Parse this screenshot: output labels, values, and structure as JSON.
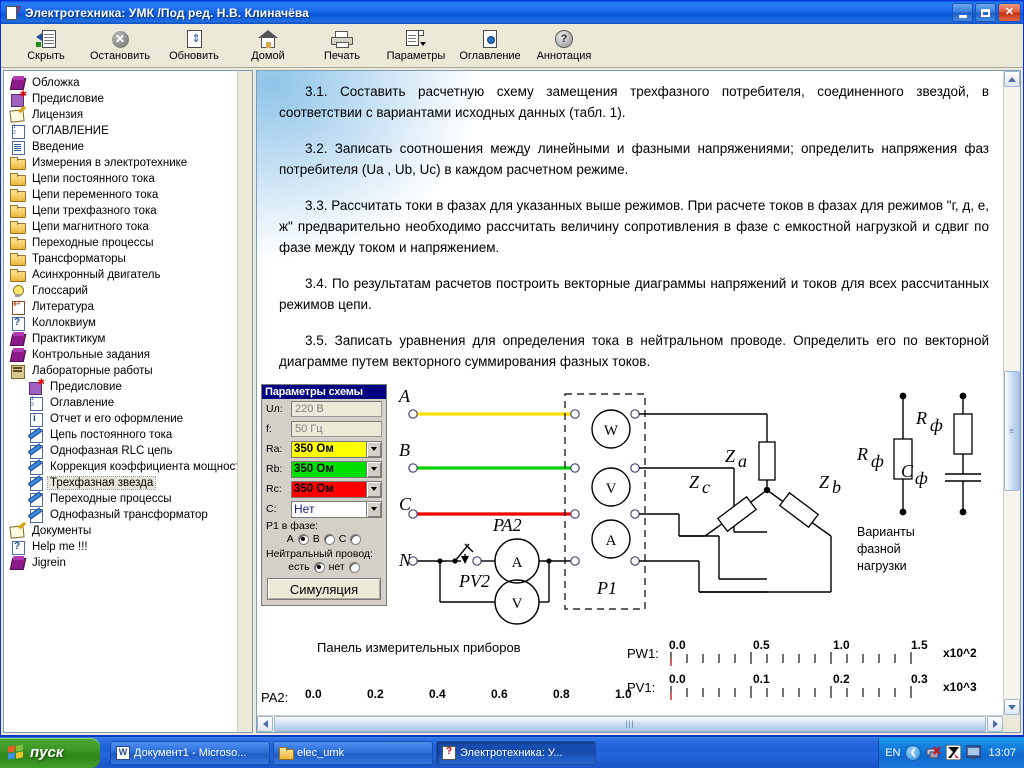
{
  "window": {
    "title": "Электротехника: УМК /Под ред. Н.В. Клиначёва",
    "icon": "help-book-icon",
    "minimize_label": "_",
    "maximize_label": "□",
    "close_label": "✕"
  },
  "toolbar": {
    "items": [
      {
        "label": "Скрыть",
        "icon": "hide-pane-icon"
      },
      {
        "label": "Остановить",
        "icon": "stop-icon"
      },
      {
        "label": "Обновить",
        "icon": "refresh-icon"
      },
      {
        "label": "Домой",
        "icon": "home-icon"
      },
      {
        "label": "Печать",
        "icon": "print-icon"
      },
      {
        "label": "Параметры",
        "icon": "options-icon"
      },
      {
        "label": "Оглавление",
        "icon": "contents-icon"
      },
      {
        "label": "Аннотация",
        "icon": "annotation-icon"
      }
    ]
  },
  "sidebar": {
    "items": [
      {
        "label": "Обложка",
        "icon": "book-icon",
        "level": 1,
        "selected": false
      },
      {
        "label": "Предисловие",
        "icon": "book-new-icon",
        "level": 1,
        "selected": false
      },
      {
        "label": "Лицензия",
        "icon": "license-icon",
        "level": 1,
        "selected": false
      },
      {
        "label": "ОГЛАВЛЕНИЕ",
        "icon": "numbered-list-icon",
        "level": 1,
        "selected": false
      },
      {
        "label": "Введение",
        "icon": "document-icon",
        "level": 1,
        "selected": false
      },
      {
        "label": "Измерения в электротехнике",
        "icon": "folder-icon",
        "level": 1,
        "selected": false
      },
      {
        "label": "Цепи постоянного тока",
        "icon": "folder-icon",
        "level": 1,
        "selected": false
      },
      {
        "label": "Цепи переменного тока",
        "icon": "folder-icon",
        "level": 1,
        "selected": false
      },
      {
        "label": "Цепи трехфазного тока",
        "icon": "folder-icon",
        "level": 1,
        "selected": false
      },
      {
        "label": "Цепи магнитного тока",
        "icon": "folder-icon",
        "level": 1,
        "selected": false
      },
      {
        "label": "Переходные процессы",
        "icon": "folder-icon",
        "level": 1,
        "selected": false
      },
      {
        "label": "Трансформаторы",
        "icon": "folder-icon",
        "level": 1,
        "selected": false
      },
      {
        "label": "Асинхронный двигатель",
        "icon": "folder-icon",
        "level": 1,
        "selected": false
      },
      {
        "label": "Глоссарий",
        "icon": "lightbulb-icon",
        "level": 1,
        "selected": false
      },
      {
        "label": "Литература",
        "icon": "literature-icon",
        "level": 1,
        "selected": false
      },
      {
        "label": "Коллоквиум",
        "icon": "question-icon",
        "level": 1,
        "selected": false
      },
      {
        "label": "Практиктикум",
        "icon": "book-icon",
        "level": 1,
        "selected": false
      },
      {
        "label": "Контрольные задания",
        "icon": "book-icon",
        "level": 1,
        "selected": false
      },
      {
        "label": "Лабораторные работы",
        "icon": "lab-folder-icon",
        "level": 1,
        "selected": false
      },
      {
        "label": "Предисловие",
        "icon": "document-new-icon",
        "level": 2,
        "selected": false
      },
      {
        "label": "Оглавление",
        "icon": "numbered-list-icon",
        "level": 2,
        "selected": false
      },
      {
        "label": "Отчет и его оформление",
        "icon": "info-icon",
        "level": 2,
        "selected": false
      },
      {
        "label": "Цепь постоянного тока",
        "icon": "lab-icon",
        "level": 2,
        "selected": false
      },
      {
        "label": "Однофазная RLC цепь",
        "icon": "lab-icon",
        "level": 2,
        "selected": false
      },
      {
        "label": "Коррекция коэффициента мощности",
        "icon": "lab-icon",
        "level": 2,
        "selected": false
      },
      {
        "label": "Трехфазная звезда",
        "icon": "lab-icon",
        "level": 2,
        "selected": true
      },
      {
        "label": "Переходные процессы",
        "icon": "lab-icon",
        "level": 2,
        "selected": false
      },
      {
        "label": "Однофазный трансформатор",
        "icon": "lab-icon",
        "level": 2,
        "selected": false
      },
      {
        "label": "Документы",
        "icon": "license-icon",
        "level": 1,
        "selected": false
      },
      {
        "label": "Help me !!!",
        "icon": "question-icon",
        "level": 1,
        "selected": false
      },
      {
        "label": "Jigrein",
        "icon": "book-icon",
        "level": 1,
        "selected": false
      }
    ]
  },
  "content": {
    "paragraphs": [
      "3.1. Составить расчетную схему замещения трехфазного потребителя, соединенного звездой, в соответствии с вариантами исходных данных (табл. 1).",
      "3.2. Записать соотношения между линейными и фазными напряжениями; определить напряжения фаз потребителя (Ua , Ub, Uc) в каждом расчетном режиме.",
      "3.3. Рассчитать токи в фазах для указанных выше режимов. При расчете токов в фазах для режимов \"г, д, е, ж\" предварительно необходимо рассчитать величину сопротивления в фазе с емкостной нагрузкой и сдвиг по фазе между током и напряжением.",
      "3.4. По результатам расчетов построить векторные диаграммы напряжений и токов для всех рассчитанных режимов цепи.",
      "3.5. Записать уравнения для определения тока в нейтральном проводе. Определить его по векторной диаграмме путем векторного суммирования фазных токов."
    ]
  },
  "params_panel": {
    "title": "Параметры схемы",
    "fields": [
      {
        "label": "Uл:",
        "value": "220 В",
        "type": "readonly"
      },
      {
        "label": "f:",
        "value": "50 Гц",
        "type": "readonly"
      },
      {
        "label": "Ra:",
        "value": "350 Ом",
        "type": "combo",
        "color": "#ffff00"
      },
      {
        "label": "Rb:",
        "value": "350 Ом",
        "type": "combo",
        "color": "#00e000"
      },
      {
        "label": "Rc:",
        "value": "350 Ом",
        "type": "combo",
        "color": "#ff0000"
      },
      {
        "label": "C:",
        "value": "Нет",
        "type": "combo-wide",
        "color": "#ffffff"
      }
    ],
    "phase_group_label": "P1 в фазе:",
    "phase_options": [
      {
        "label": "A",
        "selected": true
      },
      {
        "label": "B",
        "selected": false
      },
      {
        "label": "C",
        "selected": false
      }
    ],
    "neutral_group_label": "Нейтральный провод:",
    "neutral_options": [
      {
        "label": "есть",
        "selected": true
      },
      {
        "label": "нет",
        "selected": false
      }
    ],
    "simulate_button": "Симуляция"
  },
  "circuit": {
    "terminal_labels": [
      "A",
      "B",
      "C",
      "N"
    ],
    "phase_colors": {
      "A": "#ffe000",
      "B": "#00d000",
      "C": "#ee0000"
    },
    "meter_block_label": "P1",
    "meter_block_items": [
      "W",
      "V",
      "A"
    ],
    "ammeter_label": "PA2",
    "voltmeter_label": "PV2",
    "ammeter_symbol": "A",
    "voltmeter_symbol": "V",
    "load_labels": [
      "Za",
      "Zc",
      "Zb"
    ],
    "variants_title_lines": [
      "Варианты",
      "фазной",
      "нагрузки"
    ],
    "variant1": {
      "r": "R",
      "r_sub": "ф"
    },
    "variant2": {
      "r": "R",
      "r_sub": "ф",
      "c": "C",
      "c_sub": "ф"
    }
  },
  "meters": {
    "panel_title": "Панель измерительных приборов",
    "scales": [
      {
        "name": "PA2:",
        "labels": [
          "0.0",
          "0.2",
          "0.4",
          "0.6",
          "0.8",
          "1.0"
        ],
        "multiplier": ""
      },
      {
        "name": "PW1:",
        "labels": [
          "0.0",
          "0.5",
          "1.0",
          "1.5"
        ],
        "multiplier": "x10^2"
      },
      {
        "name": "PV1:",
        "labels": [
          "0.0",
          "0.1",
          "0.2",
          "0.3"
        ],
        "multiplier": "x10^3"
      }
    ]
  },
  "taskbar": {
    "start_label": "пуск",
    "tasks": [
      {
        "label": "Документ1 - Microso...",
        "icon": "word-icon",
        "active": false
      },
      {
        "label": "elec_umk",
        "icon": "folder-icon",
        "active": false
      },
      {
        "label": "Электротехника: У...",
        "icon": "help-book-icon",
        "active": true
      }
    ],
    "tray": {
      "language": "EN",
      "chevron": "❮",
      "icons": [
        "network-disconnected-icon",
        "antivirus-icon",
        "display-icon"
      ],
      "time": "13:07"
    }
  }
}
